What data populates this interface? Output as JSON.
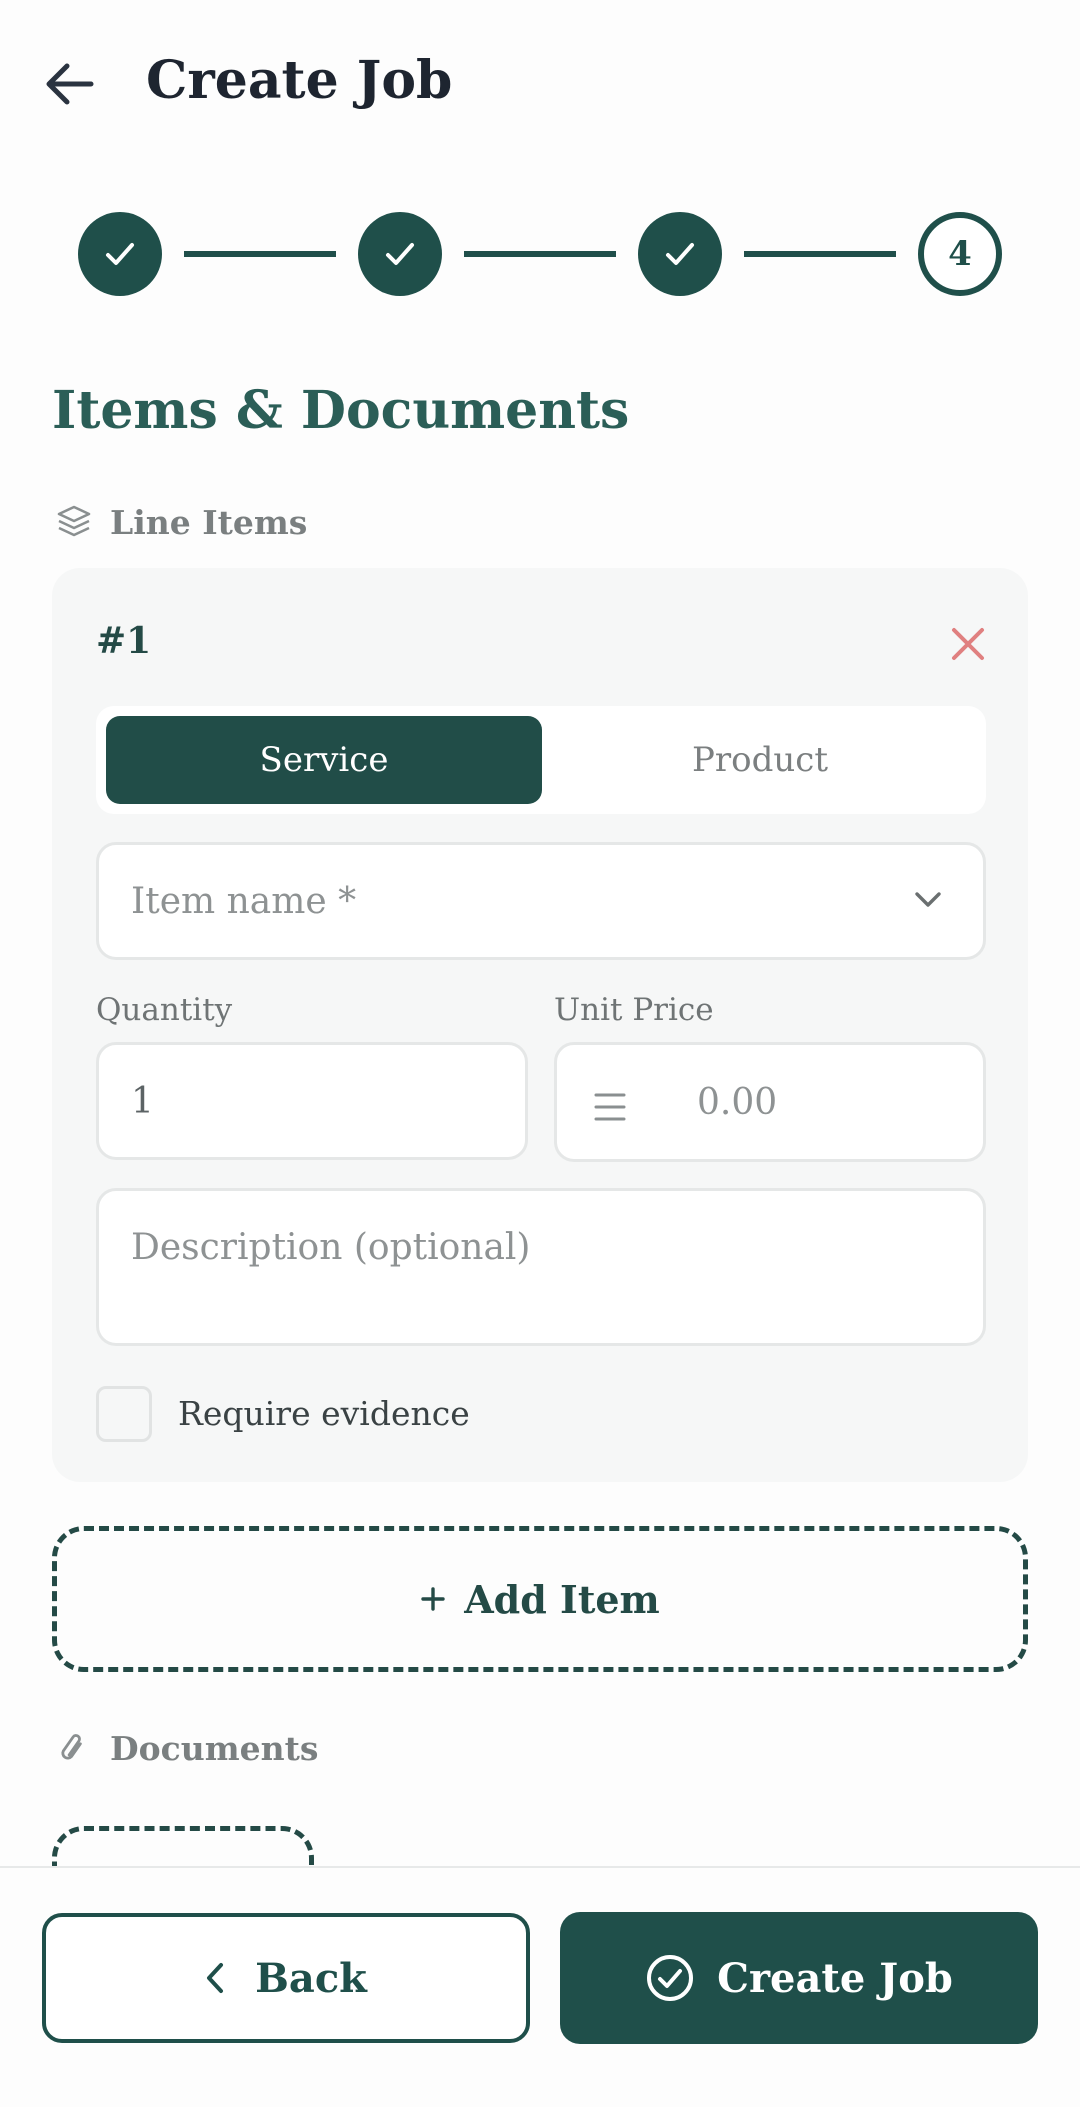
{
  "header": {
    "title": "Create Job"
  },
  "stepper": {
    "steps": [
      {
        "status": "complete"
      },
      {
        "status": "complete"
      },
      {
        "status": "complete"
      },
      {
        "status": "current",
        "label": "4"
      }
    ]
  },
  "section": {
    "title": "Items & Documents"
  },
  "line_items": {
    "label": "Line Items",
    "items": [
      {
        "number": "#1",
        "type_options": [
          "Service",
          "Product"
        ],
        "selected_type": "Service",
        "item_name_placeholder": "Item name *",
        "quantity_label": "Quantity",
        "quantity_value": "1",
        "unit_price_label": "Unit Price",
        "unit_price_placeholder": "0.00",
        "description_placeholder": "Description (optional)",
        "require_evidence_label": "Require evidence",
        "require_evidence_checked": false
      }
    ],
    "add_item_label": "Add Item"
  },
  "documents": {
    "label": "Documents"
  },
  "footer": {
    "back_label": "Back",
    "create_label": "Create Job"
  },
  "colors": {
    "primary": "#1f4f4a",
    "accent_heading": "#2b5e57",
    "remove": "#e08080"
  }
}
